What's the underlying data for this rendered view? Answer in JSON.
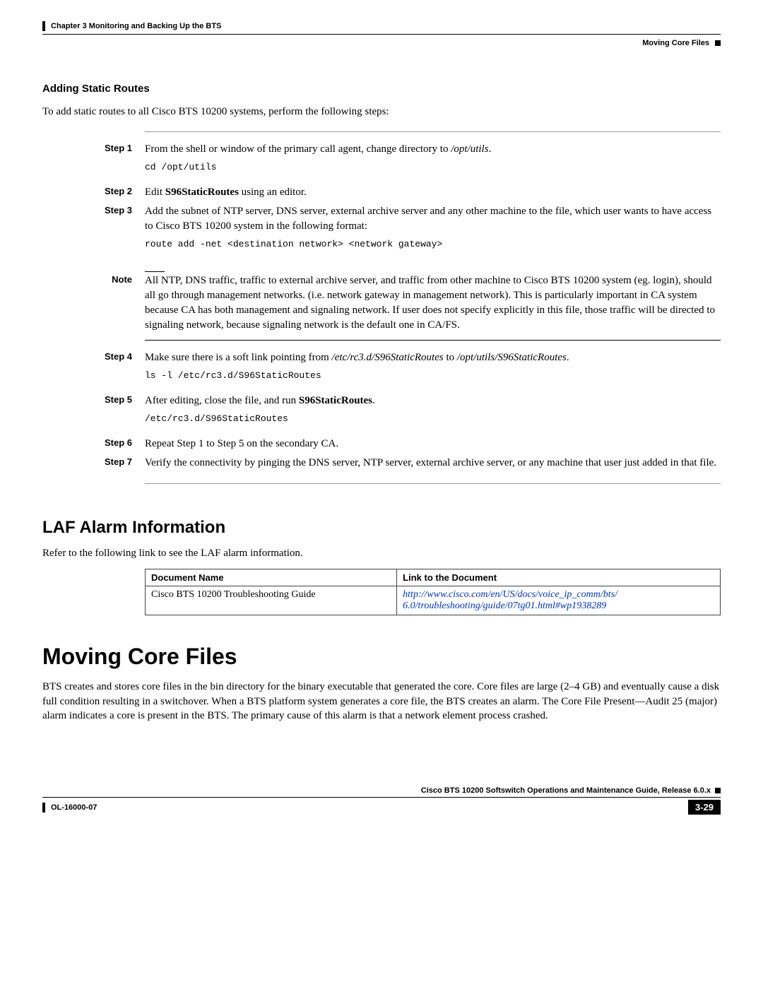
{
  "header": {
    "chapter": "Chapter 3    Monitoring and Backing Up the BTS",
    "section": "Moving Core Files"
  },
  "s1": {
    "title": "Adding Static Routes",
    "intro": "To add static routes to all Cisco BTS 10200 systems, perform the following steps:",
    "steps": {
      "s1_label": "Step 1",
      "s1_a": "From the shell or window of the primary call agent, change directory to ",
      "s1_b": "/opt/utils",
      "s1_c": ".",
      "s1_cmd": "cd /opt/utils",
      "s2_label": "Step 2",
      "s2_a": "Edit ",
      "s2_b": "S96StaticRoutes",
      "s2_c": " using an editor.",
      "s3_label": "Step 3",
      "s3_text": "Add the subnet of NTP server, DNS server, external archive server and any other machine to the file, which user wants to have access to Cisco BTS 10200 system in the following format:",
      "s3_cmd": "route add -net <destination network> <network gateway>",
      "note_label": "Note",
      "note_text": "All NTP, DNS traffic, traffic to external archive server, and traffic from other machine to Cisco BTS 10200 system (eg. login), should all go through management networks. (i.e. network gateway in management network). This is particularly important in CA system because CA has both management and signaling network. If user does not specify explicitly in this file, those traffic will be directed to signaling network, because signaling network is the default one in CA/FS.",
      "s4_label": "Step 4",
      "s4_a": "Make sure there is a soft link pointing from ",
      "s4_b": "/etc/rc3.d/S96StaticRoutes",
      "s4_c": " to ",
      "s4_d": "/opt/utils/S96StaticRoutes",
      "s4_e": ".",
      "s4_cmd": "ls -l /etc/rc3.d/S96StaticRoutes",
      "s5_label": "Step 5",
      "s5_a": "After editing, close the file, and run ",
      "s5_b": "S96StaticRoutes",
      "s5_c": ".",
      "s5_cmd": "/etc/rc3.d/S96StaticRoutes",
      "s6_label": "Step 6",
      "s6_text": "Repeat Step 1 to Step 5 on the secondary CA.",
      "s7_label": "Step 7",
      "s7_text": "Verify the connectivity by pinging the DNS server, NTP server, external archive server, or any machine that user just added in that file."
    }
  },
  "s2": {
    "title": "LAF Alarm Information",
    "intro": "Refer to the following link to see the LAF alarm information.",
    "th1": "Document Name",
    "th2": "Link to the Document",
    "td1": "Cisco BTS 10200 Troubleshooting Guide",
    "td2a": "http://www.cisco.com/en/US/docs/voice_ip_comm/bts/",
    "td2b": "6.0/troubleshooting/guide/07tg01.html#wp1938289"
  },
  "s3": {
    "title": "Moving Core Files",
    "para": "BTS creates and stores core files in the bin directory for the binary executable that generated the core. Core files are large (2–4 GB) and eventually cause a disk full condition resulting in a switchover. When a BTS platform system generates a core file, the BTS creates an alarm. The Core File Present—Audit 25 (major) alarm indicates a core is present in the BTS. The primary cause of this alarm is that a network element process crashed."
  },
  "footer": {
    "book": "Cisco BTS 10200 Softswitch Operations and Maintenance Guide, Release 6.0.x",
    "docid": "OL-16000-07",
    "page": "3-29"
  }
}
